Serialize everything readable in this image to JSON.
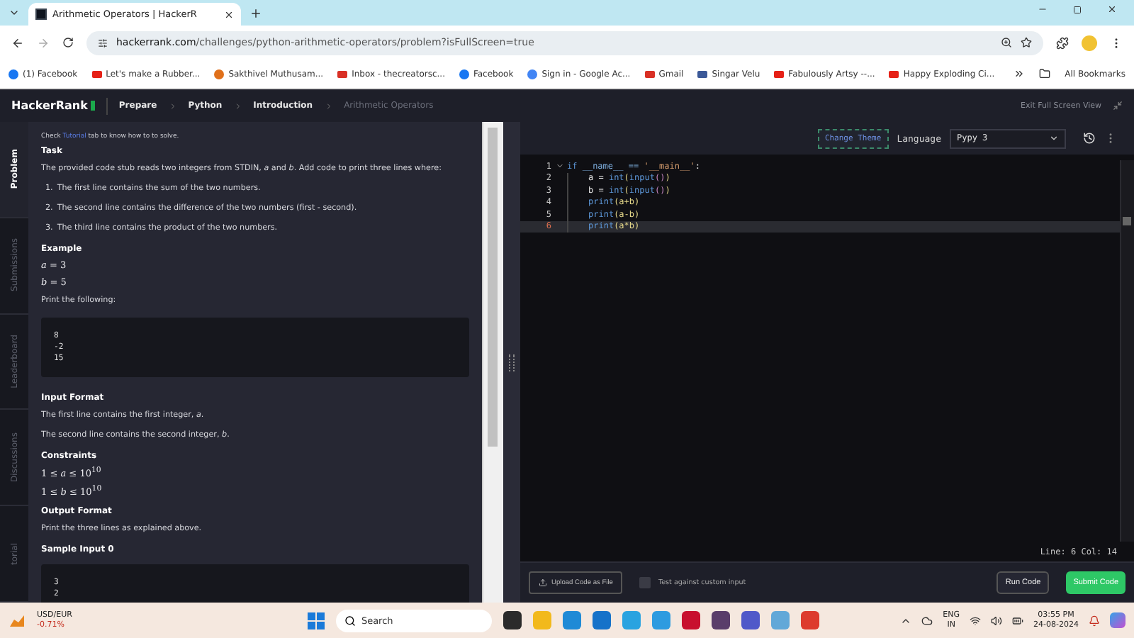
{
  "browser": {
    "tab": {
      "title": "Arithmetic Operators | HackerR",
      "selected": true
    },
    "address": {
      "host": "hackerrank.com",
      "path": "/challenges/python-arithmetic-operators/problem?isFullScreen=true"
    },
    "bookmarks": [
      {
        "label": "(1) Facebook",
        "kind": "round",
        "color": "#1877f2"
      },
      {
        "label": "Let's make a Rubber...",
        "kind": "square",
        "color": "#e62117"
      },
      {
        "label": "Sakthivel Muthusam...",
        "kind": "round",
        "color": "#e0701a"
      },
      {
        "label": "Inbox - thecreatorsc...",
        "kind": "square",
        "color": "#d93025"
      },
      {
        "label": "Facebook",
        "kind": "round",
        "color": "#1877f2"
      },
      {
        "label": "Sign in - Google Ac...",
        "kind": "round",
        "color": "#4285f4"
      },
      {
        "label": "Gmail",
        "kind": "square",
        "color": "#d93025"
      },
      {
        "label": "Singar Velu",
        "kind": "square",
        "color": "#3b5998"
      },
      {
        "label": "Fabulously Artsy --...",
        "kind": "square",
        "color": "#e62117"
      },
      {
        "label": "Happy Exploding Ci...",
        "kind": "square",
        "color": "#e62117"
      }
    ],
    "all_bookmarks": "All Bookmarks"
  },
  "header": {
    "logo": "HackerRank",
    "breadcrumbs": [
      {
        "label": "Prepare",
        "selected": false
      },
      {
        "label": "Python",
        "selected": false
      },
      {
        "label": "Introduction",
        "selected": false
      },
      {
        "label": "Arithmetic Operators",
        "selected": true
      }
    ],
    "exit": "Exit Full Screen View"
  },
  "side_tabs": [
    {
      "label": "Problem",
      "selected": true
    },
    {
      "label": "Submissions",
      "selected": false
    },
    {
      "label": "Leaderboard",
      "selected": false
    },
    {
      "label": "Discussions",
      "selected": false
    },
    {
      "label": "torial",
      "selected": false
    }
  ],
  "problem": {
    "hint": {
      "before": "Check",
      "link": "Tutorial",
      "after": "tab to know how to to solve."
    },
    "blocks": [
      {
        "kind": "heading",
        "text": "Task"
      },
      {
        "kind": "paragraph",
        "text": "The provided code stub reads two integers from STDIN, *a* and *b*. Add code to print three lines where:"
      },
      {
        "kind": "item",
        "number": "1.",
        "text": "The first line contains the sum of the two numbers."
      },
      {
        "kind": "item",
        "number": "2.",
        "text": "The second line contains the difference of the two numbers (first - second)."
      },
      {
        "kind": "item",
        "number": "3.",
        "text": "The third line contains the product of the two numbers."
      },
      {
        "kind": "heading",
        "text": "Example"
      },
      {
        "kind": "math",
        "text": "*a* = 3"
      },
      {
        "kind": "math",
        "text": "*b* = 5"
      },
      {
        "kind": "paragraph",
        "text": "Print the following:"
      },
      {
        "kind": "code",
        "lines": [
          "8",
          "-2",
          "15"
        ]
      },
      {
        "kind": "heading",
        "text": "Input Format"
      },
      {
        "kind": "paragraph",
        "text": "The first line contains the first integer, *a*."
      },
      {
        "kind": "paragraph",
        "text": "The second line contains the second integer, *b*."
      },
      {
        "kind": "heading",
        "text": "Constraints"
      },
      {
        "kind": "math",
        "text": "1 ≤ *a* ≤ 10$^{10}$"
      },
      {
        "kind": "math",
        "text": "1 ≤ *b* ≤ 10$^{10}$"
      },
      {
        "kind": "heading",
        "text": "Output Format"
      },
      {
        "kind": "paragraph",
        "text": "Print the three lines as explained above."
      },
      {
        "kind": "heading",
        "text": "Sample Input 0"
      },
      {
        "kind": "code",
        "lines": [
          "3",
          "2"
        ]
      }
    ]
  },
  "editor": {
    "change_theme": "Change Theme",
    "language_label": "Language",
    "language": "Pypy 3",
    "lines": [
      {
        "number": "1",
        "current": false,
        "tokens": [
          {
            "text": "if ",
            "kind": "kw"
          },
          {
            "text": "__name__ == ",
            "kind": "name"
          },
          {
            "text": "'__main__'",
            "kind": "str"
          },
          {
            "text": ":",
            "kind": "plain"
          }
        ]
      },
      {
        "number": "2",
        "current": false,
        "tokens": [
          {
            "text": "a = ",
            "kind": "plain"
          },
          {
            "text": "int",
            "kind": "kw"
          },
          {
            "text": "(",
            "kind": "paren"
          },
          {
            "text": "input",
            "kind": "kw"
          },
          {
            "text": "()",
            "kind": "paren2"
          },
          {
            "text": ")",
            "kind": "paren"
          }
        ]
      },
      {
        "number": "3",
        "current": false,
        "tokens": [
          {
            "text": "b = ",
            "kind": "plain"
          },
          {
            "text": "int",
            "kind": "kw"
          },
          {
            "text": "(",
            "kind": "paren"
          },
          {
            "text": "input",
            "kind": "kw"
          },
          {
            "text": "()",
            "kind": "paren2"
          },
          {
            "text": ")",
            "kind": "paren"
          }
        ]
      },
      {
        "number": "4",
        "current": false,
        "tokens": [
          {
            "text": "print",
            "kind": "kw"
          },
          {
            "text": "(a+b)",
            "kind": "paren"
          }
        ]
      },
      {
        "number": "5",
        "current": false,
        "tokens": [
          {
            "text": "print",
            "kind": "kw"
          },
          {
            "text": "(a-b)",
            "kind": "paren"
          }
        ]
      },
      {
        "number": "6",
        "current": true,
        "tokens": [
          {
            "text": "print",
            "kind": "kw"
          },
          {
            "text": "(a*b)",
            "kind": "paren"
          }
        ]
      }
    ],
    "status": "Line: 6 Col: 14",
    "upload": "Upload Code as File",
    "custom_input": {
      "label": "Test against custom input",
      "checked": false
    },
    "run": "Run Code",
    "submit": "Submit Code"
  },
  "taskbar": {
    "ticker": "USD/EUR",
    "change": "-0.71%",
    "search": "Search",
    "apps": [
      {
        "color": "#2b2b2b"
      },
      {
        "color": "#f2b91c"
      },
      {
        "color": "#1f8ad6"
      },
      {
        "color": "#1672c9"
      },
      {
        "color": "#2aa3e0"
      },
      {
        "color": "#2d9be0"
      },
      {
        "color": "#c8102e"
      },
      {
        "color": "#5a3d6a"
      },
      {
        "color": "#5059c9"
      },
      {
        "color": "#62a8d8"
      },
      {
        "color": "#dd3b2e"
      }
    ],
    "lang": "ENG",
    "region": "IN",
    "time": "03:55 PM",
    "date": "24-08-2024"
  }
}
